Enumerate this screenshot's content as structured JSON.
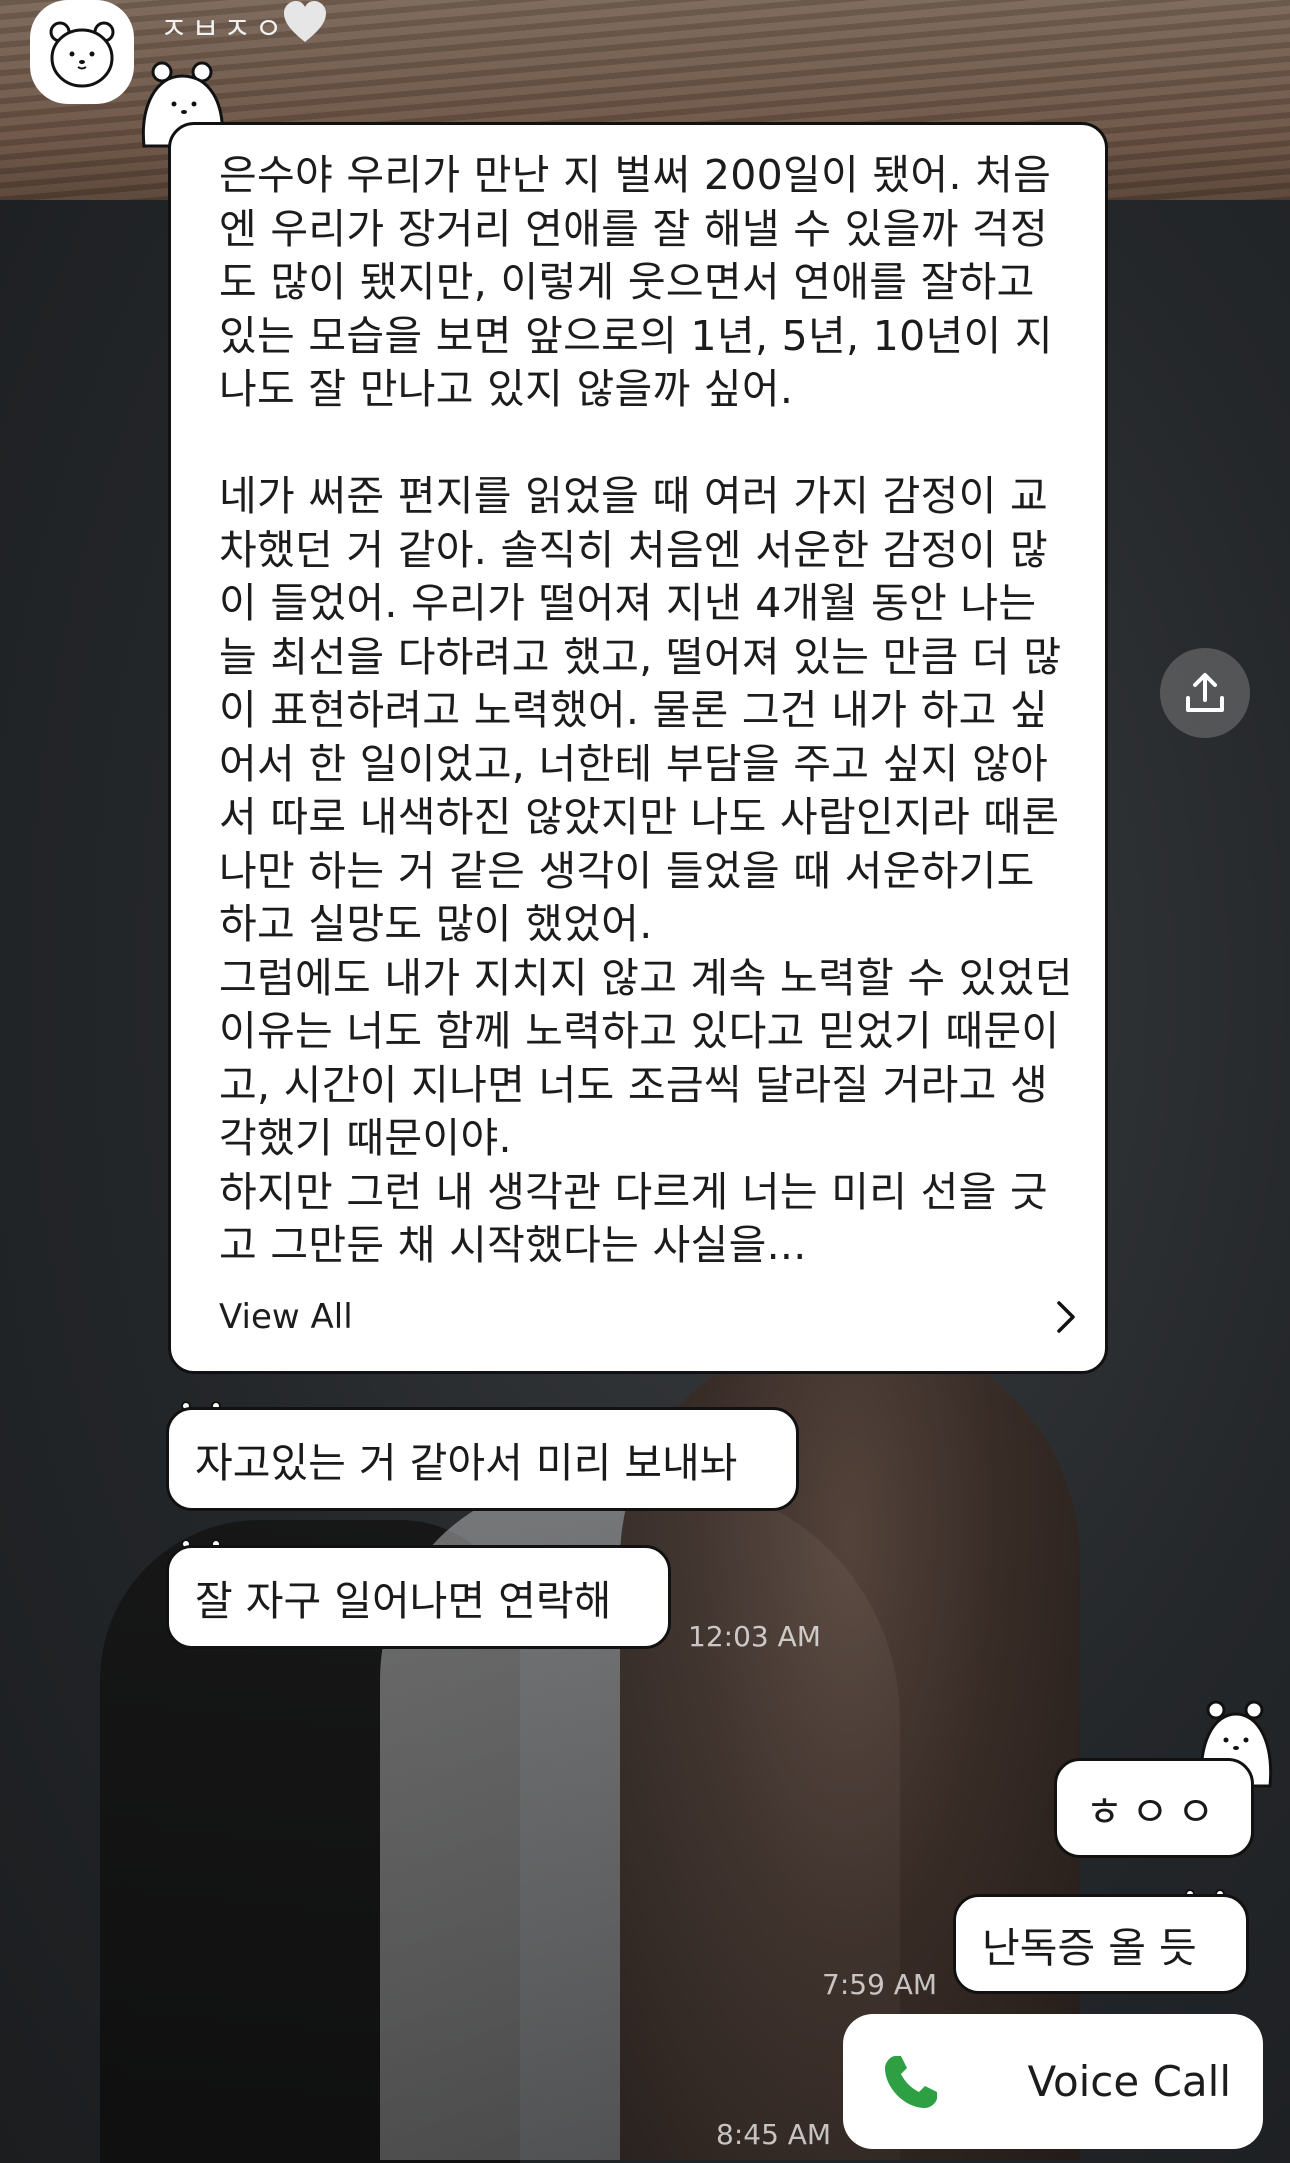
{
  "header": {
    "sender_name": "ㅈㅂㅈㅇ",
    "heart_icon": "heart-icon"
  },
  "letter": {
    "body": "은수야 우리가 만난 지 벌써 200일이 됐어. 처음\n엔 우리가 장거리 연애를 잘 해낼 수 있을까 걱정\n도 많이 됐지만, 이렇게 웃으면서 연애를 잘하고\n있는 모습을 보면 앞으로의 1년, 5년, 10년이 지\n나도 잘 만나고 있지 않을까 싶어.\n\n네가 써준 편지를 읽었을 때 여러 가지 감정이 교\n차했던 거 같아. 솔직히 처음엔 서운한 감정이 많\n이 들었어. 우리가 떨어져 지낸 4개월 동안 나는\n늘 최선을 다하려고 했고, 떨어져 있는 만큼 더 많\n이 표현하려고 노력했어. 물론 그건 내가 하고 싶\n어서 한 일이었고, 너한테 부담을 주고 싶지 않아\n서 따로 내색하진 않았지만 나도 사람인지라 때론\n나만 하는 거 같은 생각이 들었을 때 서운하기도\n하고 실망도 많이 했었어.\n그럼에도 내가 지치지 않고 계속 노력할 수 있었던\n이유는 너도 함께 노력하고 있다고 믿었기 때문이\n고, 시간이 지나면 너도 조금씩 달라질 거라고 생\n각했기 때문이야.\n하지만 그런 내 생각관 다르게 너는 미리 선을 긋\n고 그만둔 채 시작했다는 사실을...",
    "view_all_label": "View All"
  },
  "messages": [
    {
      "text": "자고있는 거 같아서 미리 보내놔"
    },
    {
      "text": "잘 자구 일어나면 연락해"
    },
    {
      "text": "ㅎㅇㅇ"
    },
    {
      "text": "난독증 올 듯"
    }
  ],
  "timestamps": [
    "12:03 AM",
    "7:59 AM",
    "8:45 AM"
  ],
  "call": {
    "label": "Voice Call",
    "icon": "phone-icon",
    "icon_color": "#2ea043"
  },
  "share": {
    "icon": "share-icon"
  }
}
